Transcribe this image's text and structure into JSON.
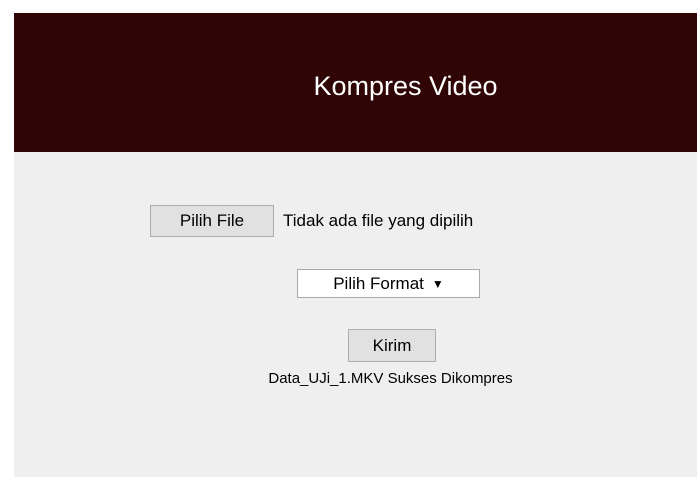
{
  "header": {
    "title": "Kompres Video"
  },
  "form": {
    "file_button_label": "Pilih File",
    "file_status": "Tidak ada file yang dipilih",
    "format_select_value": "Pilih Format",
    "format_arrow": "▼",
    "submit_label": "Kirim"
  },
  "result": {
    "message": "Data_UJi_1.MKV Sukses Dikompres"
  },
  "colors": {
    "header_bg": "#300505",
    "panel_bg": "#efefef",
    "button_bg": "#e1e1e1"
  }
}
